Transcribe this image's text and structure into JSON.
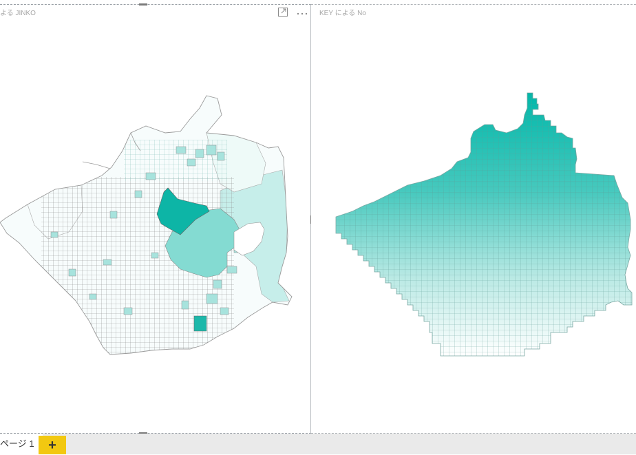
{
  "visuals": {
    "left": {
      "title": "よる JINKO",
      "focus_icon": "focus-mode-icon",
      "more_icon": "more-options-icon"
    },
    "right": {
      "title": "KEY による No"
    }
  },
  "colors": {
    "accent": "#01b8aa",
    "low": "#f2fbfa",
    "stroke_light": "#9e9e9e",
    "stroke_grid": "#6fa9a3",
    "add_page": "#f2c811"
  },
  "footer": {
    "page_tab_label": "ページ 1",
    "add_page_label": "+"
  }
}
